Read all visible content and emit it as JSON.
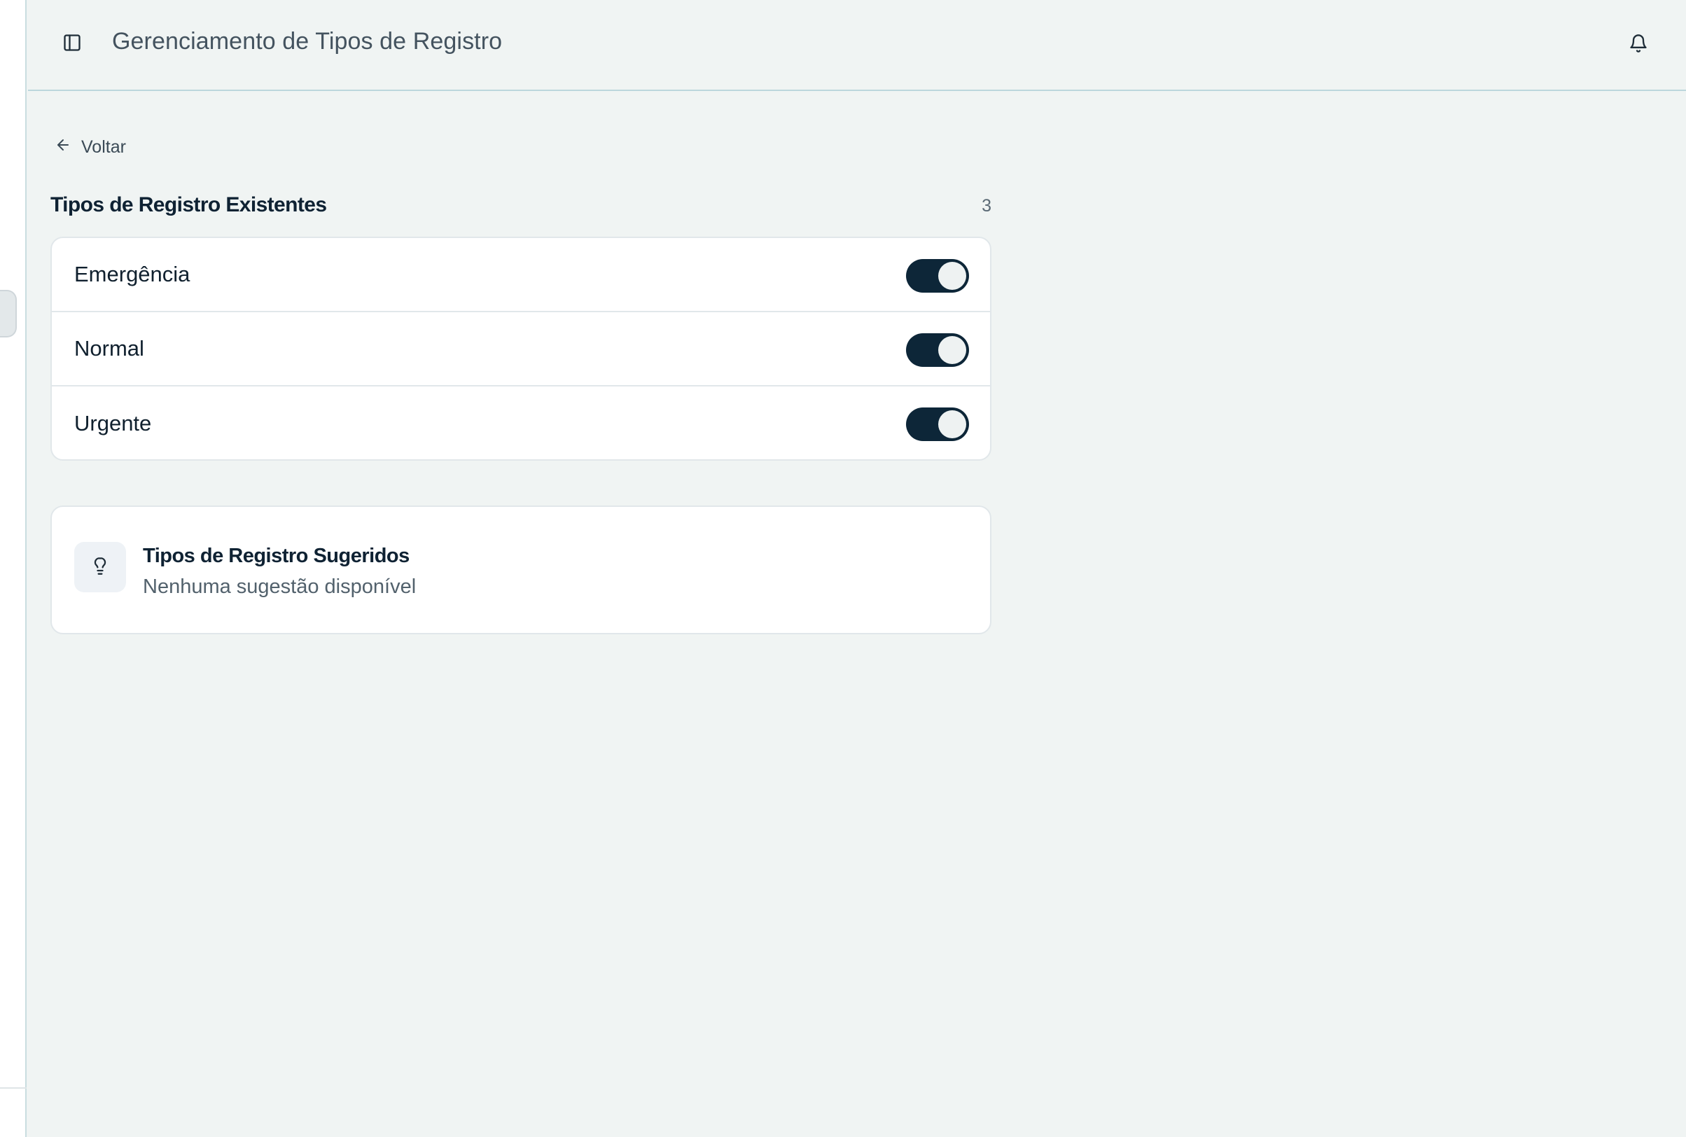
{
  "header": {
    "title": "Gerenciamento de Tipos de Registro",
    "sidebar_toggle_icon": "panel-left-icon",
    "notification_icon": "bell-icon"
  },
  "nav": {
    "back_label": "Voltar",
    "back_icon": "arrow-left-icon"
  },
  "existing": {
    "title": "Tipos de Registro Existentes",
    "count": "3",
    "items": [
      {
        "label": "Emergência",
        "enabled": true
      },
      {
        "label": "Normal",
        "enabled": true
      },
      {
        "label": "Urgente",
        "enabled": true
      }
    ]
  },
  "suggested": {
    "icon": "lightbulb-icon",
    "title": "Tipos de Registro Sugeridos",
    "empty_message": "Nenhuma sugestão disponível"
  },
  "colors": {
    "background": "#f0f4f3",
    "toggle_on": "#0d2638",
    "card": "#ffffff",
    "border": "#e1e7ea"
  }
}
